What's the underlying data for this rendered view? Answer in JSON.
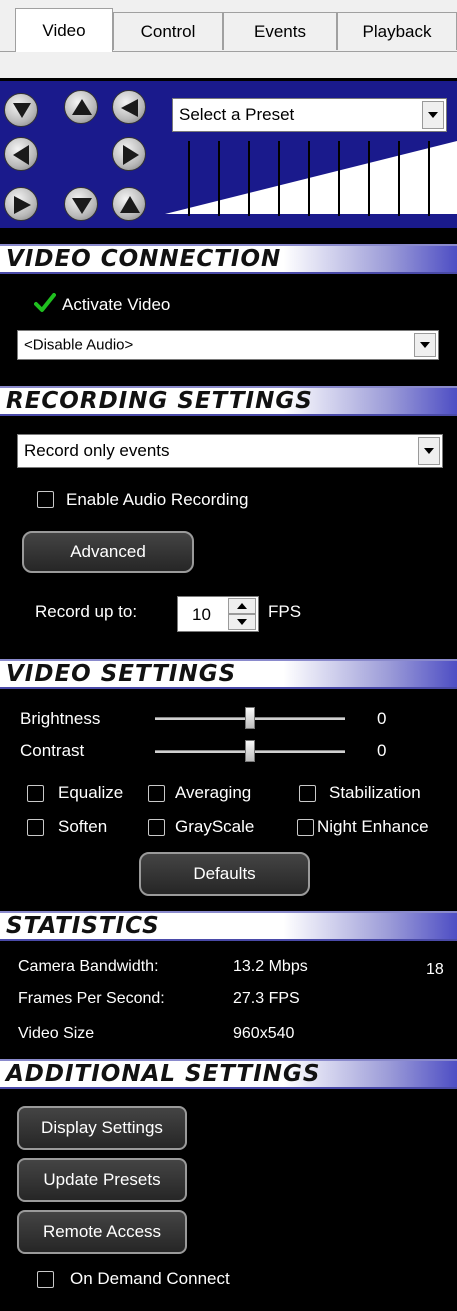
{
  "tabs": [
    "Video",
    "Control",
    "Events",
    "Playback"
  ],
  "ptz": {
    "preset_select": "Select a Preset",
    "buttons": [
      "up-left",
      "up",
      "up-right",
      "left",
      "right",
      "down-left",
      "down",
      "down-right"
    ],
    "zoom_level": 0
  },
  "video_connection": {
    "title": "VIDEO CONNECTION",
    "activate_label": "Activate Video",
    "activate_checked": true,
    "audio_select": "<Disable Audio>"
  },
  "recording_settings": {
    "title": "RECORDING SETTINGS",
    "mode_select": "Record only events",
    "audio_recording_label": "Enable Audio Recording",
    "audio_recording_checked": false,
    "advanced_label": "Advanced",
    "record_up_to_label": "Record up to:",
    "fps_value": "10",
    "fps_unit": "FPS"
  },
  "video_settings": {
    "title": "VIDEO SETTINGS",
    "brightness_label": "Brightness",
    "brightness_value": "0",
    "contrast_label": "Contrast",
    "contrast_value": "0",
    "brightness_level": 0.5,
    "contrast_level": 0.5,
    "options": [
      "Equalize",
      "Averaging",
      "Stabilization",
      "Soften",
      "GrayScale",
      "Night Enhance"
    ],
    "defaults_label": "Defaults"
  },
  "statistics": {
    "title": "STATISTICS",
    "bandwidth_label": "Camera Bandwidth:",
    "bandwidth_value": "13.2 Mbps",
    "extra_value": "18",
    "fps_label": "Frames Per Second:",
    "fps_value": "27.3 FPS",
    "size_label": "Video Size",
    "size_value": "960x540"
  },
  "additional_settings": {
    "title": "ADDITIONAL SETTINGS",
    "display_settings_label": "Display Settings",
    "update_presets_label": "Update Presets",
    "remote_access_label": "Remote Access",
    "on_demand_label": "On Demand Connect",
    "on_demand_checked": false
  },
  "colors": {
    "ptz_background": "#1a1a8c",
    "header_gradient_end": "#4e4ec4",
    "check_green": "#1fbf1f"
  }
}
